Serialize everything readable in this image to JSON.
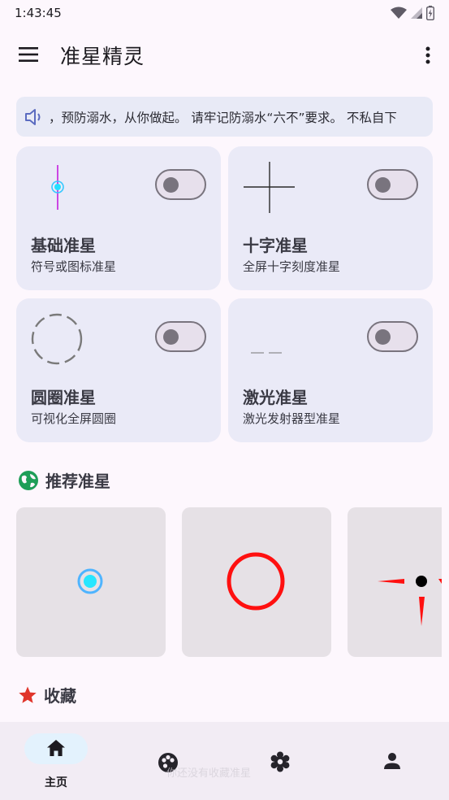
{
  "status_bar": {
    "time": "1:43:45"
  },
  "app_bar": {
    "title": "准星精灵"
  },
  "notice": {
    "text": "，预防溺水，从你做起。 请牢记防溺水“六不”要求。 不私自下"
  },
  "crosshair_cards": [
    {
      "title": "基础准星",
      "subtitle": "符号或图标准星",
      "enabled": false
    },
    {
      "title": "十字准星",
      "subtitle": "全屏十字刻度准星",
      "enabled": false
    },
    {
      "title": "圆圈准星",
      "subtitle": "可视化全屏圆圈",
      "enabled": false
    },
    {
      "title": "激光准星",
      "subtitle": "激光发射器型准星",
      "enabled": false
    }
  ],
  "recommended": {
    "title": "推荐准星"
  },
  "favorites": {
    "title": "收藏",
    "empty_hint": "你还没有收藏准星"
  },
  "bottom_nav": {
    "items": [
      {
        "label": "主页",
        "active": true
      }
    ]
  },
  "colors": {
    "accent_green": "#1e9e58",
    "star_red": "#e0352b",
    "nav_pill": "#e3f2fd"
  }
}
